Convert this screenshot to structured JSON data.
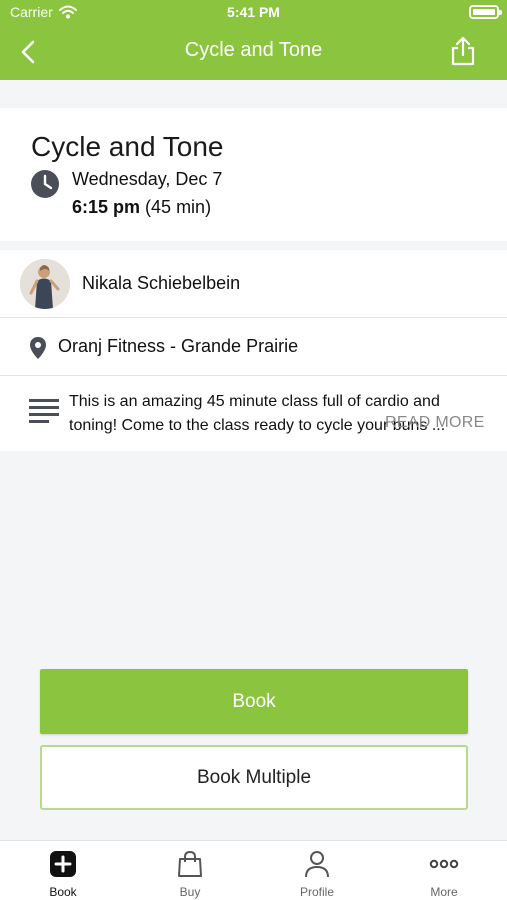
{
  "status_bar": {
    "carrier": "Carrier",
    "time": "5:41 PM"
  },
  "nav": {
    "title": "Cycle and Tone",
    "back_icon": "chevron-left-icon",
    "share_icon": "share-icon"
  },
  "class": {
    "title": "Cycle and Tone",
    "date": "Wednesday, Dec 7",
    "time": "6:15 pm",
    "duration": "(45 min)"
  },
  "instructor": {
    "name": "Nikala Schiebelbein"
  },
  "location": {
    "name": "Oranj Fitness - Grande Prairie"
  },
  "description": {
    "text": "This is an amazing 45 minute class full of cardio and toning!  Come to the class ready to cycle your buns ...",
    "read_more": "READ MORE"
  },
  "actions": {
    "book": "Book",
    "book_multiple": "Book Multiple"
  },
  "tabbar": {
    "items": [
      {
        "label": "Book",
        "icon": "plus-square-icon",
        "active": true
      },
      {
        "label": "Buy",
        "icon": "shopping-bag-icon",
        "active": false
      },
      {
        "label": "Profile",
        "icon": "person-icon",
        "active": false
      },
      {
        "label": "More",
        "icon": "more-dots-icon",
        "active": false
      }
    ]
  },
  "colors": {
    "brand_green": "#8bc53f",
    "light_green_border": "#b7da8c",
    "background": "#f4f5f6"
  }
}
